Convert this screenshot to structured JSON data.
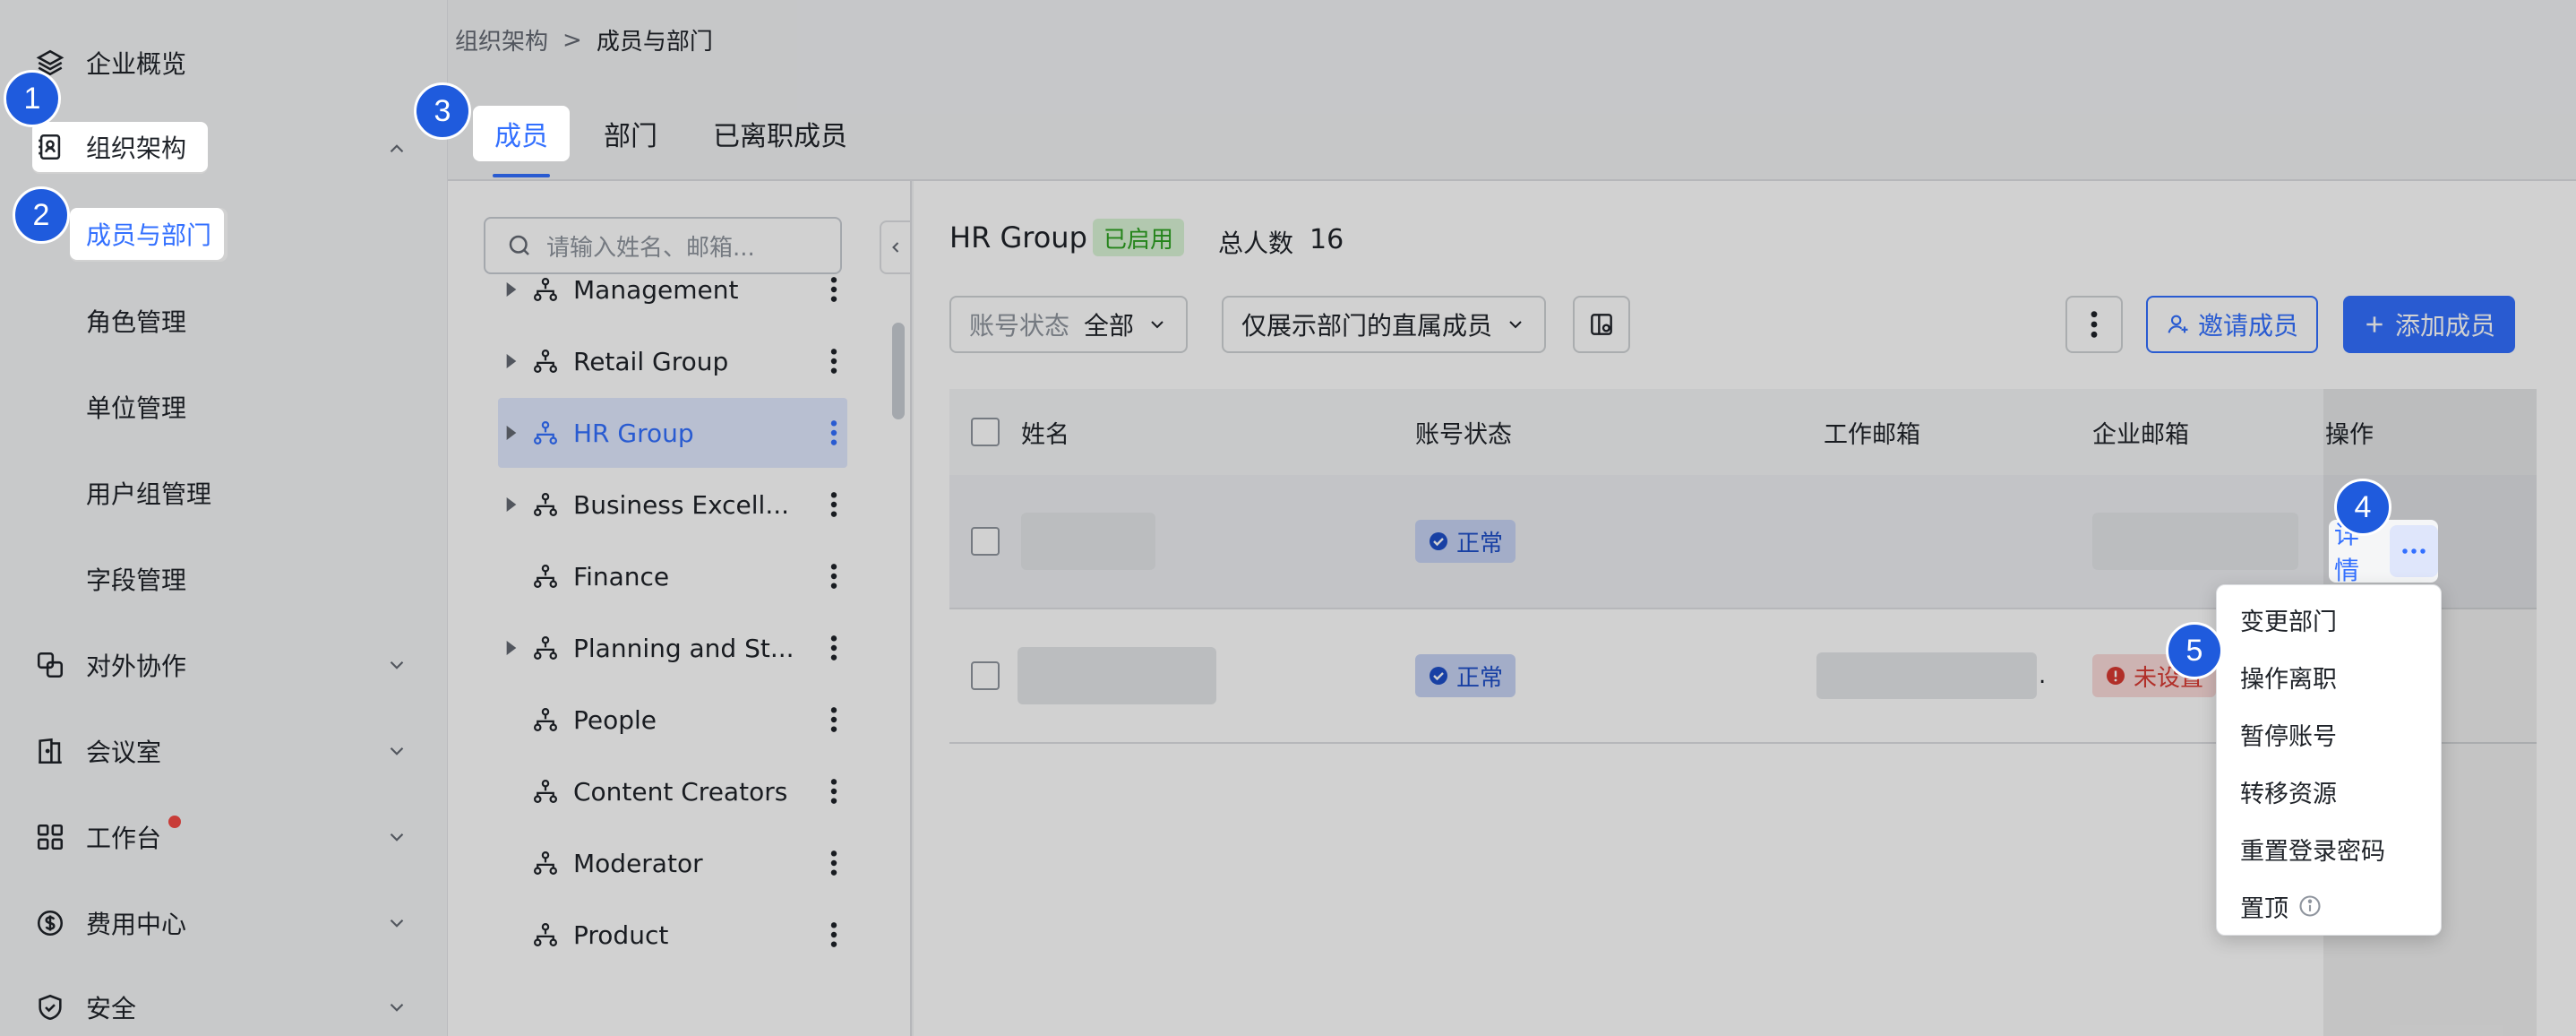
{
  "sidebar": {
    "items": [
      {
        "label": "企业概览",
        "icon": "layers-icon"
      },
      {
        "label": "组织架构",
        "icon": "contacts-icon"
      },
      {
        "label": "成员与部门"
      },
      {
        "label": "角色管理"
      },
      {
        "label": "单位管理"
      },
      {
        "label": "用户组管理"
      },
      {
        "label": "字段管理"
      },
      {
        "label": "对外协作",
        "icon": "external-icon"
      },
      {
        "label": "会议室",
        "icon": "meeting-room-icon"
      },
      {
        "label": "工作台",
        "icon": "grid-icon"
      },
      {
        "label": "费用中心",
        "icon": "dollar-icon"
      },
      {
        "label": "安全",
        "icon": "shield-icon"
      }
    ]
  },
  "breadcrumb": {
    "parent": "组织架构",
    "separator": ">",
    "current": "成员与部门"
  },
  "tabs": [
    {
      "label": "成员"
    },
    {
      "label": "部门"
    },
    {
      "label": "已离职成员"
    }
  ],
  "tree": {
    "search_placeholder": "请输入姓名、邮箱...",
    "items": [
      {
        "label": "Management",
        "expandable": true
      },
      {
        "label": "Retail Group",
        "expandable": true
      },
      {
        "label": "HR Group",
        "expandable": true
      },
      {
        "label": "Business Excell...",
        "expandable": true
      },
      {
        "label": "Finance",
        "expandable": false
      },
      {
        "label": "Planning and St...",
        "expandable": true
      },
      {
        "label": "People",
        "expandable": false
      },
      {
        "label": "Content Creators",
        "expandable": false
      },
      {
        "label": "Moderator",
        "expandable": false
      },
      {
        "label": "Product",
        "expandable": false
      }
    ]
  },
  "content": {
    "group_name": "HR Group",
    "group_status": "已启用",
    "total_label": "总人数",
    "total_value": "16",
    "filter_status_label": "账号状态",
    "filter_status_value": "全部",
    "filter_scope": "仅展示部门的直属成员",
    "invite_label": "邀请成员",
    "add_label": "添加成员",
    "columns": [
      "姓名",
      "账号状态",
      "工作邮箱",
      "企业邮箱",
      "操作"
    ],
    "rows": [
      {
        "status": "正常",
        "enterprise_email": "",
        "detail": "详情"
      },
      {
        "status": "正常",
        "work_email_suffix": ".",
        "enterprise_email": "未设置"
      }
    ]
  },
  "menu": {
    "items": [
      "变更部门",
      "操作离职",
      "暂停账号",
      "转移资源",
      "重置登录密码",
      "置顶"
    ]
  },
  "steps": [
    "1",
    "2",
    "3",
    "4",
    "5"
  ],
  "colors": {
    "accent": "#3370ff",
    "success": "#2ea121",
    "danger": "#d83931",
    "step": "#1f5bdd"
  }
}
